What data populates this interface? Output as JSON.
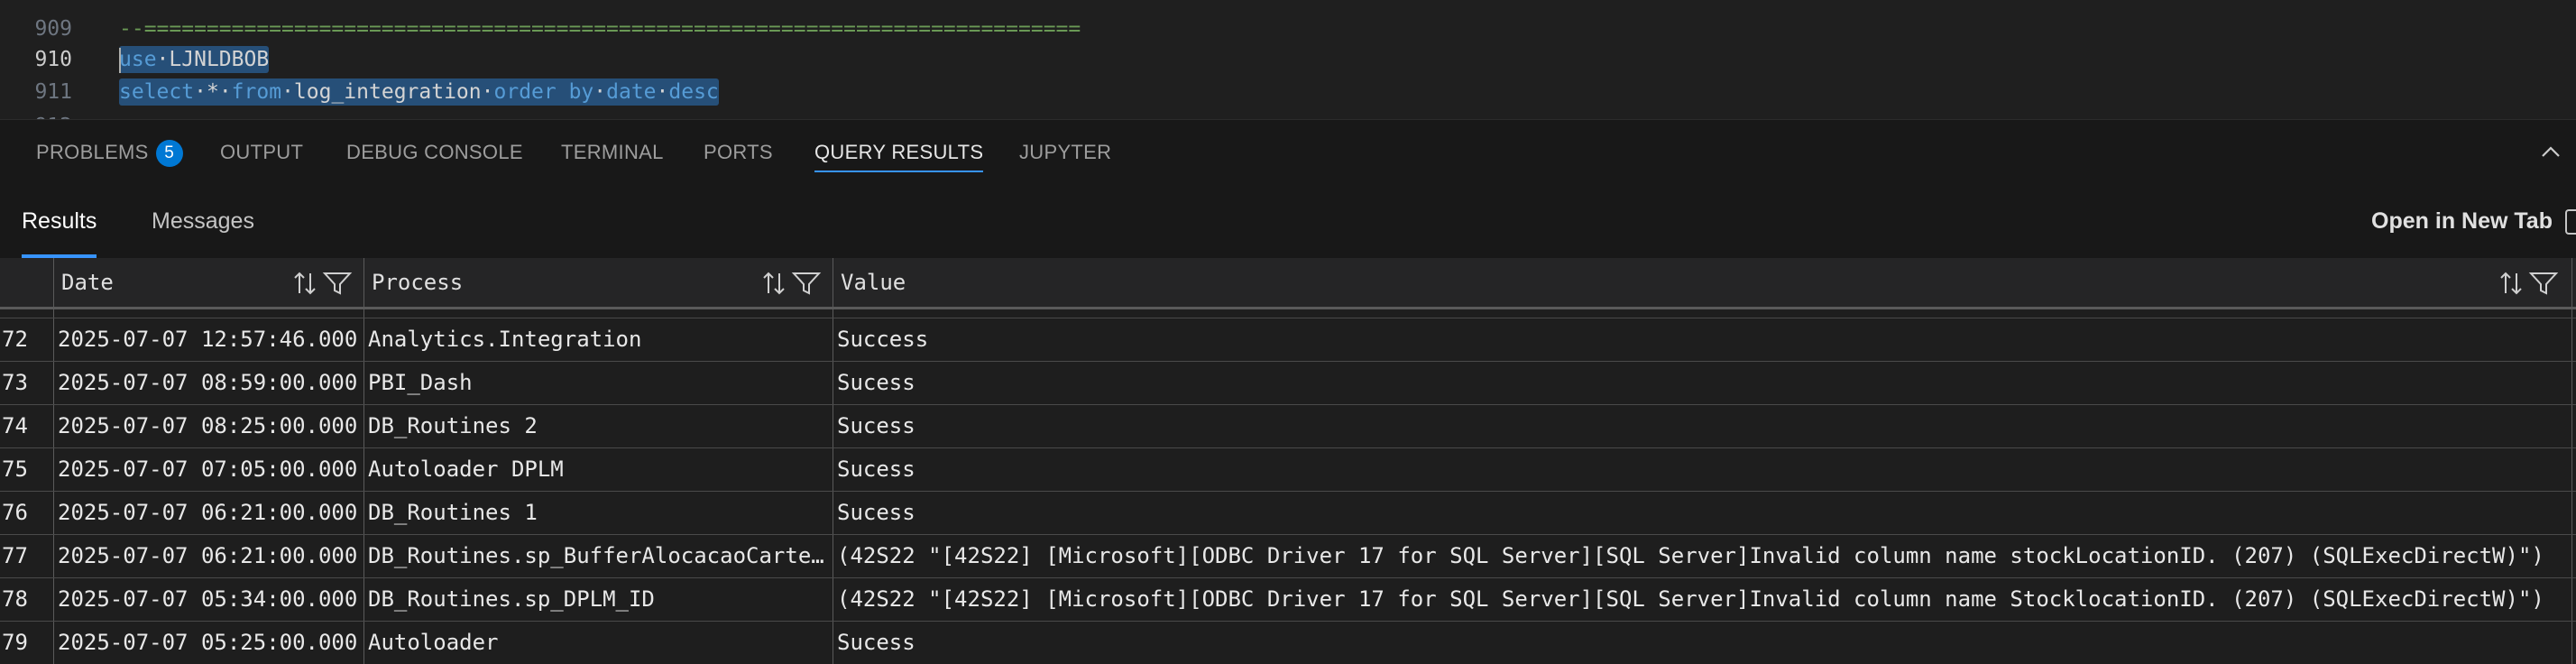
{
  "editor": {
    "lines": [
      {
        "num": "909",
        "text": "--==========================================================================="
      },
      {
        "num": "910",
        "kw": "use",
        "ident": "LJNLDBOB"
      },
      {
        "num": "911",
        "kw1": "select",
        "star": "*",
        "kw2": "from",
        "ident": "log_integration",
        "kw3": "order by",
        "ident2": "date",
        "kw4": "desc"
      }
    ]
  },
  "panel": {
    "tabs": [
      {
        "label": "PROBLEMS",
        "badge": "5"
      },
      {
        "label": "OUTPUT"
      },
      {
        "label": "DEBUG CONSOLE"
      },
      {
        "label": "TERMINAL"
      },
      {
        "label": "PORTS"
      },
      {
        "label": "QUERY RESULTS"
      },
      {
        "label": "JUPYTER"
      }
    ],
    "active_tab": "QUERY RESULTS"
  },
  "results": {
    "tabs": [
      "Results",
      "Messages"
    ],
    "open_new_tab": "Open in New Tab"
  },
  "grid": {
    "columns": [
      "Date",
      "Process",
      "Value"
    ],
    "rows": [
      {
        "n": "72",
        "date": "2025-07-07 12:57:46.000",
        "process": "Analytics.Integration",
        "value": "Success"
      },
      {
        "n": "73",
        "date": "2025-07-07 08:59:00.000",
        "process": "PBI_Dash",
        "value": "Sucess"
      },
      {
        "n": "74",
        "date": "2025-07-07 08:25:00.000",
        "process": "DB_Routines 2",
        "value": "Sucess"
      },
      {
        "n": "75",
        "date": "2025-07-07 07:05:00.000",
        "process": "Autoloader DPLM",
        "value": "Sucess"
      },
      {
        "n": "76",
        "date": "2025-07-07 06:21:00.000",
        "process": "DB_Routines 1",
        "value": "Sucess"
      },
      {
        "n": "77",
        "date": "2025-07-07 06:21:00.000",
        "process": "DB_Routines.sp_BufferAlocacaoCarte…",
        "value": "(42S22 \"[42S22] [Microsoft][ODBC Driver 17 for SQL Server][SQL Server]Invalid column name stockLocationID. (207) (SQLExecDirectW)\")"
      },
      {
        "n": "78",
        "date": "2025-07-07 05:34:00.000",
        "process": "DB_Routines.sp_DPLM_ID",
        "value": "(42S22 \"[42S22] [Microsoft][ODBC Driver 17 for SQL Server][SQL Server]Invalid column name StocklocationID. (207) (SQLExecDirectW)\")"
      },
      {
        "n": "79",
        "date": "2025-07-07 05:25:00.000",
        "process": "Autoloader",
        "value": "Sucess"
      }
    ]
  },
  "colors": {
    "accent": "#3794ff",
    "selection": "#264f78",
    "keyword": "#569cd6",
    "badge": "#0078d4"
  },
  "icons": [
    "sort-icon",
    "filter-icon",
    "chevron-up-icon"
  ]
}
